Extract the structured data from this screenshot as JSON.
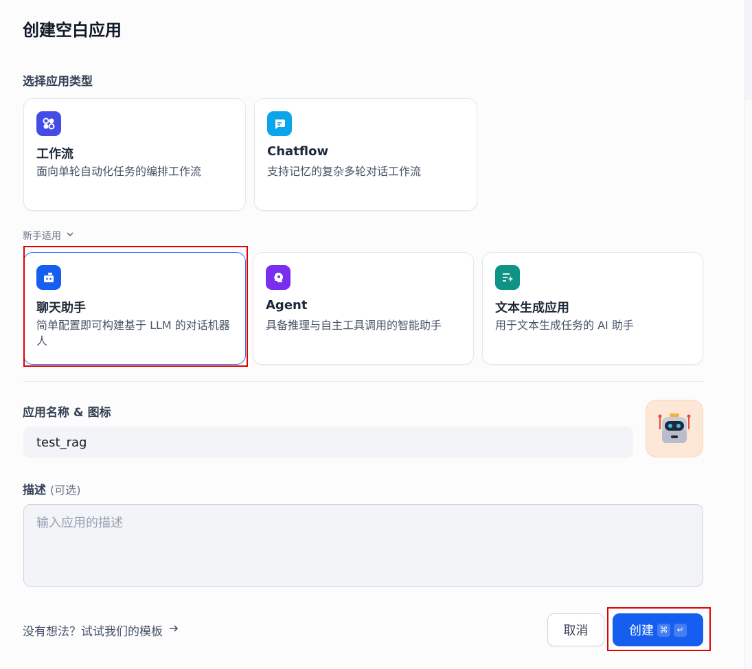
{
  "dialog": {
    "title": "创建空白应用"
  },
  "app_type": {
    "label": "选择应用类型",
    "cards": [
      {
        "title": "工作流",
        "desc": "面向单轮自动化任务的编排工作流",
        "icon": "workflow-icon",
        "color": "#444ce7"
      },
      {
        "title": "Chatflow",
        "desc": "支持记忆的复杂多轮对话工作流",
        "icon": "chatflow-icon",
        "color": "#0ba5ec"
      }
    ],
    "beginner_label": "新手适用",
    "beginner_cards": [
      {
        "title": "聊天助手",
        "desc": "简单配置即可构建基于 LLM 的对话机器人",
        "icon": "chatbot-icon",
        "color": "#155eef"
      },
      {
        "title": "Agent",
        "desc": "具备推理与自主工具调用的智能助手",
        "icon": "agent-icon",
        "color": "#7a2ef0"
      },
      {
        "title": "文本生成应用",
        "desc": "用于文本生成任务的 AI 助手",
        "icon": "text-generation-icon",
        "color": "#0e9384"
      }
    ]
  },
  "name_section": {
    "label": "应用名称 & 图标",
    "value": "test_rag",
    "avatar_icon": "robot-icon"
  },
  "description": {
    "label": "描述",
    "optional": "(可选)",
    "placeholder": "输入应用的描述"
  },
  "footer": {
    "templates_link": "没有想法？试试我们的模板",
    "cancel": "取消",
    "create": "创建",
    "shortcut_keys": [
      "⌘",
      "↵"
    ]
  }
}
